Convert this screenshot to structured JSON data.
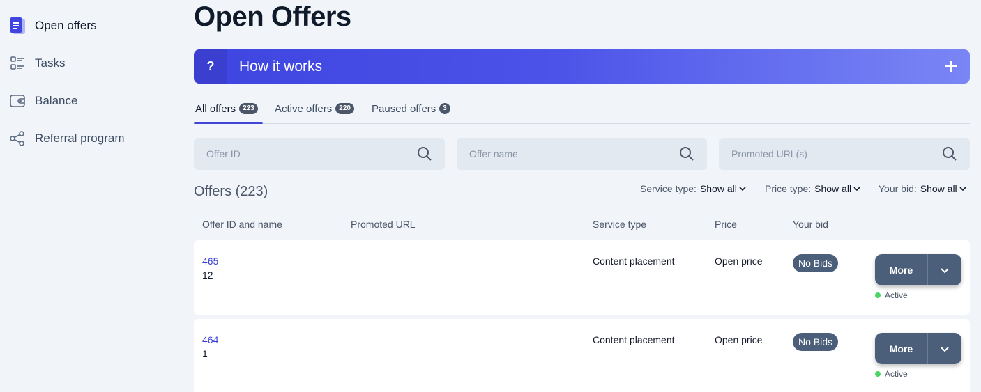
{
  "sidebar": {
    "items": [
      {
        "label": "Open offers",
        "icon": "document-icon"
      },
      {
        "label": "Tasks",
        "icon": "checklist-icon"
      },
      {
        "label": "Balance",
        "icon": "wallet-icon"
      },
      {
        "label": "Referral program",
        "icon": "share-nodes-icon"
      }
    ]
  },
  "page": {
    "title": "Open Offers"
  },
  "how_it_works": {
    "icon": "?",
    "title": "How it works",
    "expand_icon": "plus-icon"
  },
  "tabs": [
    {
      "label": "All offers",
      "count": "223"
    },
    {
      "label": "Active offers",
      "count": "220"
    },
    {
      "label": "Paused offers",
      "count": "3"
    }
  ],
  "search": {
    "offer_id_placeholder": "Offer ID",
    "offer_name_placeholder": "Offer name",
    "promoted_url_placeholder": "Promoted URL(s)"
  },
  "offers_heading": "Offers (223)",
  "filters": [
    {
      "label": "Service type:",
      "value": "Show all"
    },
    {
      "label": "Price type:",
      "value": "Show all"
    },
    {
      "label": "Your bid:",
      "value": "Show all"
    }
  ],
  "table": {
    "headers": [
      "Offer ID and name",
      "Promoted URL",
      "Service type",
      "Price",
      "Your bid"
    ],
    "rows": [
      {
        "id": "465",
        "name": "12",
        "promoted_url": "",
        "service_type": "Content placement",
        "price": "Open price",
        "bid": "No Bids",
        "action": "More",
        "status": "Active"
      },
      {
        "id": "464",
        "name": "1",
        "promoted_url": "",
        "service_type": "Content placement",
        "price": "Open price",
        "bid": "No Bids",
        "action": "More",
        "status": "Active"
      }
    ]
  },
  "colors": {
    "accent": "#4146d8",
    "link": "#3a3fcf",
    "button": "#4b5f7a",
    "status_active": "#4cd465",
    "background": "#f1f4f8"
  }
}
